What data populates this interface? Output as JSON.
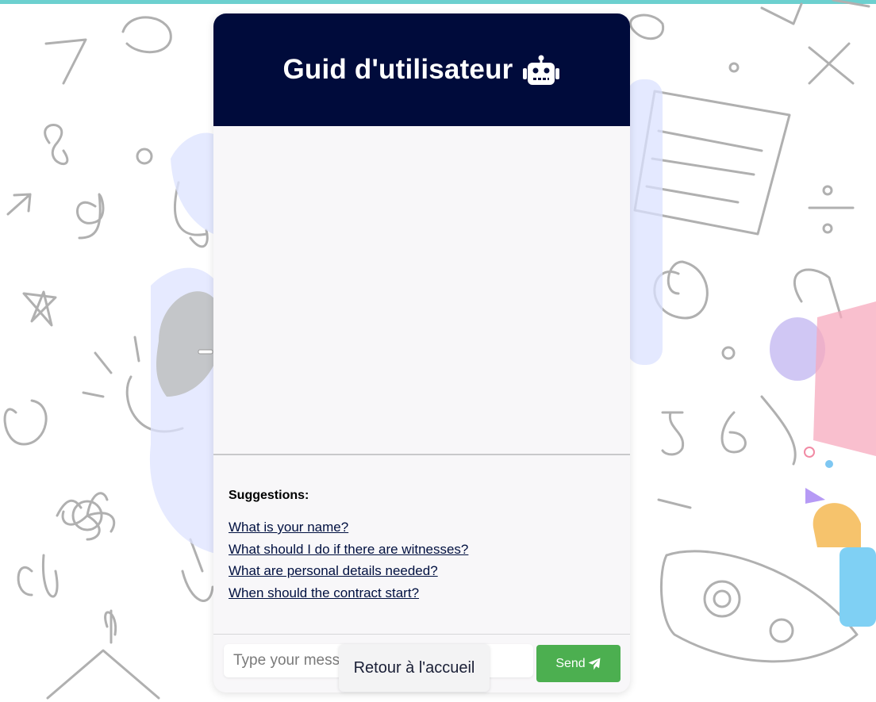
{
  "header": {
    "title": "Guid d'utilisateur",
    "icon": "robot-icon",
    "background_color": "#000b3b"
  },
  "suggestions": {
    "title": "Suggestions:",
    "items": [
      "What is your name?",
      "What should I do if there are witnesses?",
      "What are personal details needed?",
      "When should the contract start?"
    ]
  },
  "input": {
    "placeholder": "Type your message...",
    "value": ""
  },
  "send_button": {
    "label": "Send",
    "icon": "paper-plane-icon",
    "color": "#4caf50"
  },
  "home_button": {
    "label": "Retour à l'accueil"
  },
  "colors": {
    "top_strip": "#6cd0cf",
    "doodle_stroke": "#b0b0b0"
  }
}
